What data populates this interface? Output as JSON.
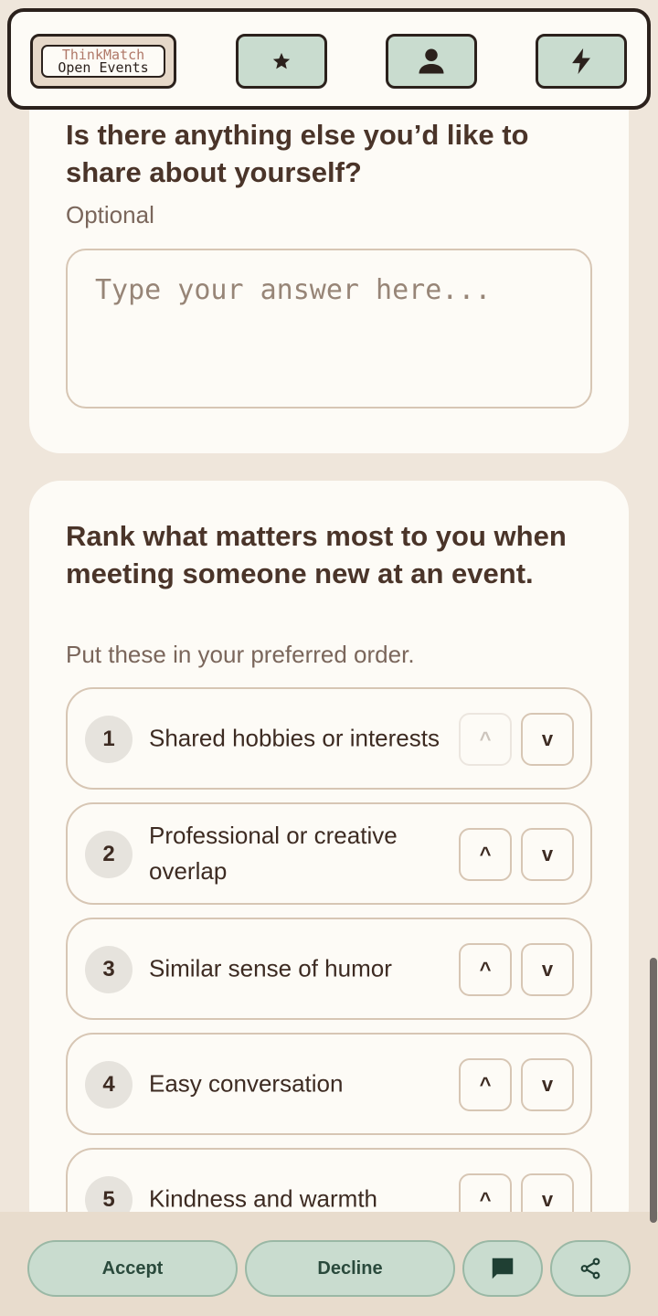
{
  "app": {
    "logo_top": "ThinkMatch",
    "logo_bottom": "Open Events"
  },
  "nav": {
    "icons": [
      "star-icon",
      "person-icon",
      "bolt-icon"
    ]
  },
  "question1": {
    "title": "Is there anything else you’d like to share about yourself?",
    "subtitle": "Optional",
    "placeholder": "Type your answer here...",
    "value": ""
  },
  "question2": {
    "title": "Rank what matters most to you when meeting someone new at an event.",
    "subtitle": "Put these in your preferred order.",
    "items": [
      {
        "rank": "1",
        "label": "Shared hobbies or interests",
        "up": "^",
        "down": "v",
        "up_disabled": true
      },
      {
        "rank": "2",
        "label": "Professional or creative overlap",
        "up": "^",
        "down": "v",
        "up_disabled": false
      },
      {
        "rank": "3",
        "label": "Similar sense of humor",
        "up": "^",
        "down": "v",
        "up_disabled": false
      },
      {
        "rank": "4",
        "label": "Easy conversation",
        "up": "^",
        "down": "v",
        "up_disabled": false
      },
      {
        "rank": "5",
        "label": "Kindness and warmth",
        "up": "^",
        "down": "v",
        "up_disabled": false
      }
    ]
  },
  "actions": {
    "accept": "Accept",
    "decline": "Decline",
    "chat_icon": "chat-icon",
    "share_icon": "share-icon"
  },
  "colors": {
    "background": "#efe6db",
    "card": "#fdfbf6",
    "accent_green": "#c9dccf",
    "text_dark": "#3d2b22"
  }
}
